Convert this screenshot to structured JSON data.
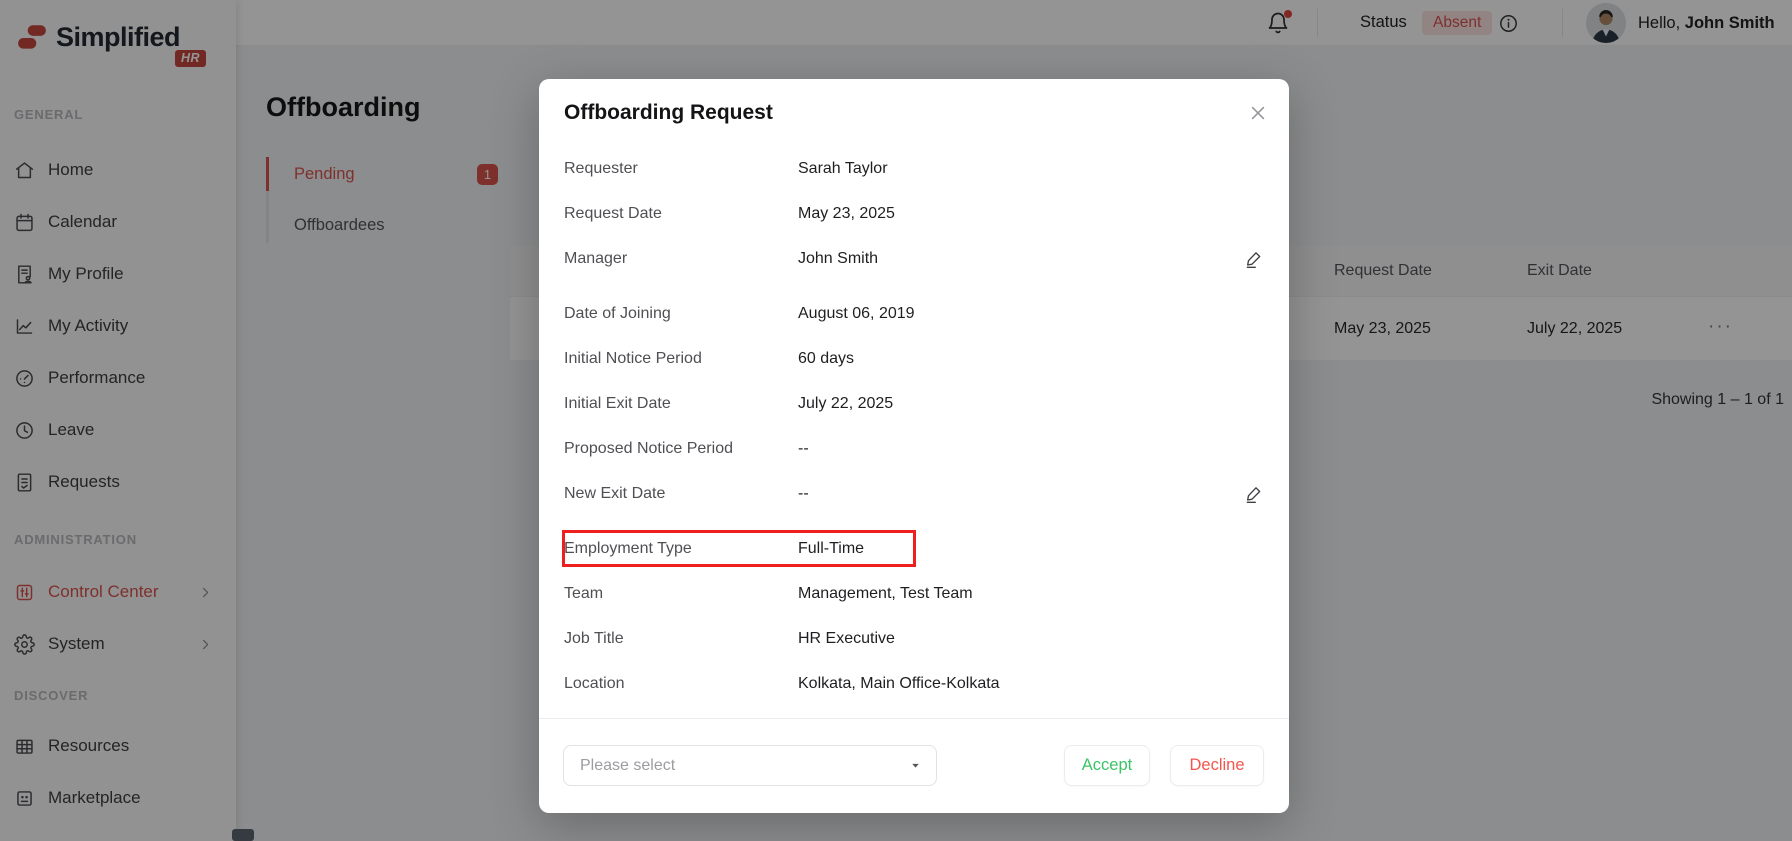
{
  "brand": {
    "name": "Simplified",
    "badge": "HR"
  },
  "header": {
    "status_label": "Status",
    "status_value": "Absent",
    "greeting_prefix": "Hello,",
    "user_name": "John Smith"
  },
  "sidebar": {
    "sections": [
      {
        "title": "GENERAL",
        "items": [
          {
            "label": "Home"
          },
          {
            "label": "Calendar"
          },
          {
            "label": "My Profile"
          },
          {
            "label": "My Activity"
          },
          {
            "label": "Performance"
          },
          {
            "label": "Leave"
          },
          {
            "label": "Requests"
          }
        ]
      },
      {
        "title": "ADMINISTRATION",
        "items": [
          {
            "label": "Control Center"
          },
          {
            "label": "System"
          }
        ]
      },
      {
        "title": "DISCOVER",
        "items": [
          {
            "label": "Resources"
          },
          {
            "label": "Marketplace"
          }
        ]
      }
    ]
  },
  "page": {
    "title": "Offboarding",
    "tabs": [
      {
        "label": "Pending",
        "badge": "1"
      },
      {
        "label": "Offboardees"
      }
    ],
    "table": {
      "columns": [
        "Request Date",
        "Exit Date"
      ],
      "rows": [
        {
          "request_date": "May 23, 2025",
          "exit_date": "July 22, 2025"
        }
      ],
      "more_icon": "···",
      "pagination": "Showing 1 – 1 of 1"
    }
  },
  "modal": {
    "title": "Offboarding Request",
    "fields": [
      {
        "label": "Requester",
        "value": "Sarah Taylor"
      },
      {
        "label": "Request Date",
        "value": "May 23, 2025"
      },
      {
        "label": "Manager",
        "value": "John Smith"
      },
      {
        "label": "Date of Joining",
        "value": "August 06, 2019"
      },
      {
        "label": "Initial Notice Period",
        "value": "60 days"
      },
      {
        "label": "Initial Exit Date",
        "value": "July 22, 2025"
      },
      {
        "label": "Proposed Notice Period",
        "value": "--"
      },
      {
        "label": "New Exit Date",
        "value": "--"
      },
      {
        "label": "Employment Type",
        "value": "Full-Time"
      },
      {
        "label": "Team",
        "value": "Management, Test Team"
      },
      {
        "label": "Job Title",
        "value": "HR Executive"
      },
      {
        "label": "Location",
        "value": "Kolkata, Main Office-Kolkata"
      }
    ],
    "footer": {
      "select_placeholder": "Please select",
      "accept_label": "Accept",
      "decline_label": "Decline"
    }
  },
  "colors": {
    "accent_red": "#d9534f",
    "brand_red": "#c4483e",
    "brand_navy": "#232a33",
    "status_badge_bg": "#fae4e2",
    "accept_green": "#3bc467",
    "decline_red": "#f2564d",
    "highlight_red": "#ed1f1f"
  }
}
